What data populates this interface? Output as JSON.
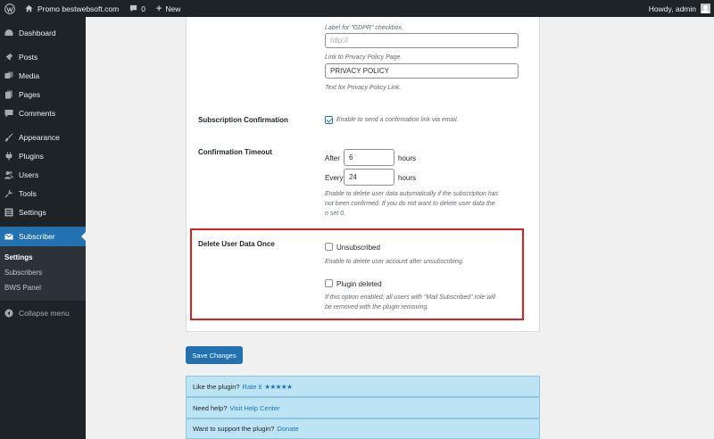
{
  "admin_bar": {
    "site_name": "Promo bestwebsoft.com",
    "comments_count": "0",
    "new_label": "New",
    "greeting": "Howdy, admin"
  },
  "sidebar": {
    "items": [
      {
        "label": "Dashboard",
        "icon": "dashboard-icon"
      },
      {
        "label": "Posts",
        "icon": "pushpin-icon"
      },
      {
        "label": "Media",
        "icon": "media-icon"
      },
      {
        "label": "Pages",
        "icon": "pages-icon"
      },
      {
        "label": "Comments",
        "icon": "comment-bubble-icon"
      },
      {
        "label": "Appearance",
        "icon": "paintbrush-icon"
      },
      {
        "label": "Plugins",
        "icon": "plug-icon"
      },
      {
        "label": "Users",
        "icon": "users-icon"
      },
      {
        "label": "Tools",
        "icon": "wrench-icon"
      },
      {
        "label": "Settings",
        "icon": "sliders-icon"
      },
      {
        "label": "Subscriber",
        "icon": "envelope-icon"
      }
    ],
    "submenu": [
      "Settings",
      "Subscribers",
      "BWS Panel"
    ],
    "collapse_label": "Collapse menu"
  },
  "form": {
    "gdpr_label_desc": "Label for \"GDPR\" checkbox.",
    "privacy_url_placeholder": "http://",
    "privacy_url_desc": "Link to Privacy Policy Page.",
    "privacy_text_value": "PRIVACY POLICY",
    "privacy_text_desc": "Text for Privacy Policy Link.",
    "subscription_confirmation": {
      "label": "Subscription Confirmation",
      "checked": true,
      "desc": "Enable to send a confirmation link via email."
    },
    "confirmation_timeout": {
      "label": "Confirmation Timeout",
      "after_label": "After",
      "after_value": "6",
      "after_unit": "hours",
      "every_label": "Every",
      "every_value": "24",
      "every_unit": "hours",
      "desc_line1": "Enable to delete user data automatically if the subscription has",
      "desc_line2": "not been confirmed. If you do not want to delete user data the",
      "desc_line3": "n set 0."
    },
    "delete_user_data": {
      "label": "Delete User Data Once",
      "unsubscribed_label": "Unsubscribed",
      "unsubscribed_checked": false,
      "unsubscribed_desc": "Enable to delete user account after unsubscribing.",
      "plugin_deleted_label": "Plugin deleted",
      "plugin_deleted_checked": false,
      "plugin_deleted_desc1": "If this option enabled, all users with \"Mail Subscribed\" role will",
      "plugin_deleted_desc2": "be removed with the plugin removing."
    }
  },
  "save_button": "Save Changes",
  "help": {
    "rate_text": "Like the plugin?",
    "rate_link": "Rate it",
    "stars": "★★★★★",
    "help_text": "Need help?",
    "help_link": "Visit Help Center",
    "support_text": "Want to support the plugin?",
    "support_link": "Donate"
  },
  "colors": {
    "accent": "#2271b1",
    "highlight_border": "#e21d1d",
    "help_box_bg": "#bde4f4"
  }
}
